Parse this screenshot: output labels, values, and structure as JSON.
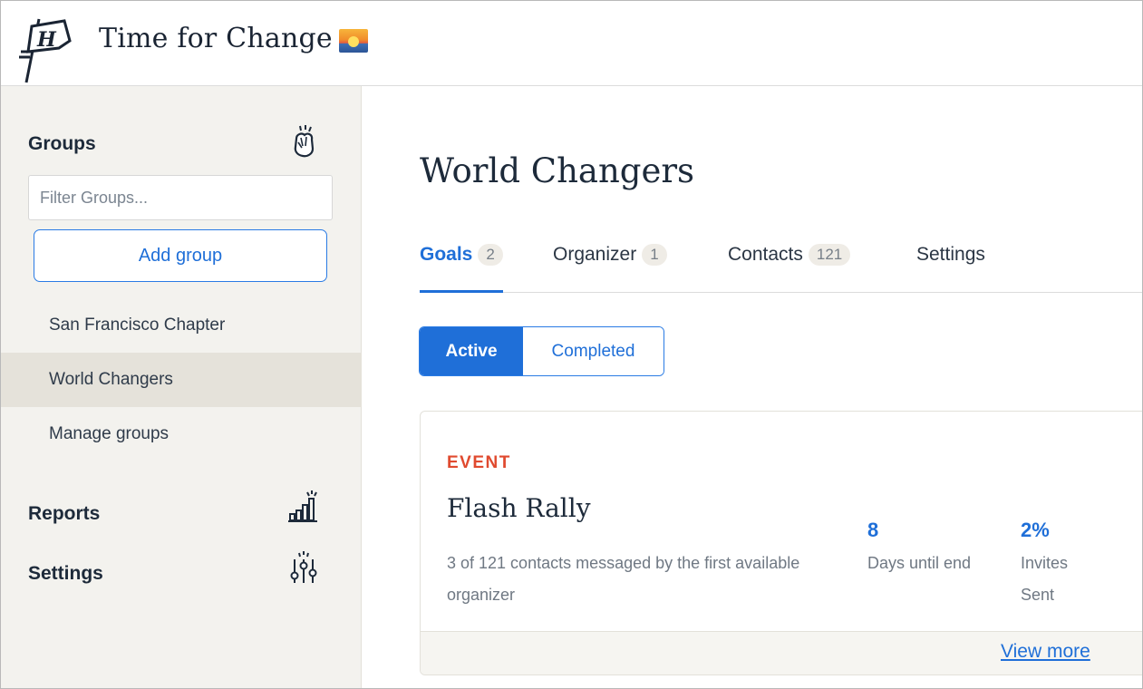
{
  "header": {
    "app_title": "Time for Change",
    "logo_icon": "flag-h-logo-icon",
    "title_emoji_icon": "sunset-icon"
  },
  "sidebar": {
    "groups_heading": "Groups",
    "groups_icon": "high-five-icon",
    "filter_placeholder": "Filter Groups...",
    "add_group_label": "Add group",
    "items": [
      {
        "label": "San Francisco Chapter",
        "active": false
      },
      {
        "label": "World Changers",
        "active": true
      },
      {
        "label": "Manage groups",
        "active": false
      }
    ],
    "reports_heading": "Reports",
    "reports_icon": "bar-chart-icon",
    "settings_heading": "Settings",
    "settings_icon": "sliders-icon"
  },
  "main": {
    "title": "World Changers",
    "tabs": [
      {
        "label": "Goals",
        "count": "2",
        "active": true
      },
      {
        "label": "Organizer",
        "count": "1",
        "active": false
      },
      {
        "label": "Contacts",
        "count": "121",
        "active": false
      },
      {
        "label": "Settings",
        "count": "",
        "active": false
      }
    ],
    "filter": {
      "active_label": "Active",
      "completed_label": "Completed",
      "selected": "Active"
    },
    "goal": {
      "type": "EVENT",
      "title": "Flash Rally",
      "description": "3 of 121 contacts messaged by the first available organizer",
      "stats": [
        {
          "value": "8",
          "label": "Days until end"
        },
        {
          "value": "2%",
          "label": "Invites Sent"
        }
      ],
      "view_more_label": "View more"
    }
  },
  "colors": {
    "accent": "#1f6fd8",
    "event_red": "#e04a2f",
    "sidebar_bg": "#f3f2ee",
    "sidebar_active": "#e5e2da"
  }
}
